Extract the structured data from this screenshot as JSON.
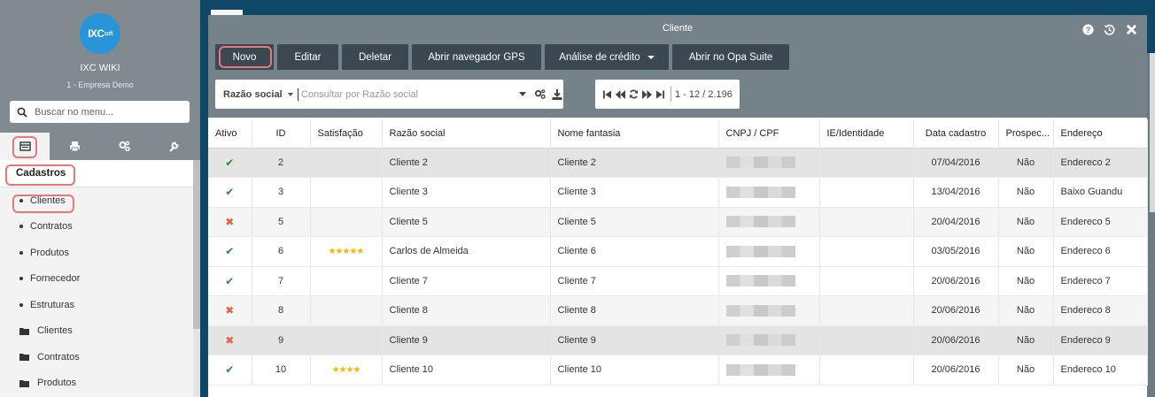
{
  "sidebar": {
    "logo_text": "IXC",
    "logo_sub": "soft",
    "app_name": "IXC WIKI",
    "company": "1 - Empresa Demo",
    "search_placeholder": "Buscar no menu...",
    "tab_icons": [
      "table-icon",
      "print-icon",
      "gears-icon",
      "wrench-icon"
    ],
    "section": "Cadastros",
    "items": [
      {
        "label": "Clientes",
        "type": "dot"
      },
      {
        "label": "Contratos",
        "type": "dot"
      },
      {
        "label": "Produtos",
        "type": "dot"
      },
      {
        "label": "Fornecedor",
        "type": "dot"
      },
      {
        "label": "Estruturas",
        "type": "dot"
      },
      {
        "label": "Clientes",
        "type": "folder"
      },
      {
        "label": "Contratos",
        "type": "folder"
      },
      {
        "label": "Produtos",
        "type": "folder"
      }
    ]
  },
  "window": {
    "title": "Cliente",
    "controls": [
      "help-icon",
      "history-icon",
      "close-icon"
    ],
    "toolbar": {
      "novo": "Novo",
      "editar": "Editar",
      "deletar": "Deletar",
      "gps": "Abrir navegador GPS",
      "credito": "Análise de crédito",
      "opa": "Abrir no Opa Suite"
    },
    "filter": {
      "field": "Razão social",
      "placeholder": "Consultar por Razão social"
    },
    "pager": {
      "info": "1 - 12 / 2.196"
    }
  },
  "table": {
    "columns": [
      "Ativo",
      "ID",
      "Satisfação",
      "Razão social",
      "Nome fantasia",
      "CNPJ / CPF",
      "IE/Identidade",
      "Data cadastro",
      "Prospec...",
      "Endereço"
    ],
    "rows": [
      {
        "ativo": "✔",
        "ok": true,
        "id": "2",
        "sat": "",
        "razao": "Cliente 2",
        "fantasia": "Cliente 2",
        "data": "07/04/2016",
        "prospec": "Não",
        "endereco": "Endereco 2"
      },
      {
        "ativo": "✔",
        "ok": true,
        "id": "3",
        "sat": "",
        "razao": "Cliente 3",
        "fantasia": "Cliente 3",
        "data": "13/04/2016",
        "prospec": "Não",
        "endereco": "Baixo Guandu"
      },
      {
        "ativo": "✖",
        "ok": false,
        "id": "5",
        "sat": "",
        "razao": "Cliente 5",
        "fantasia": "Cliente 5",
        "data": "20/04/2016",
        "prospec": "Não",
        "endereco": "Endereco 5"
      },
      {
        "ativo": "✔",
        "ok": true,
        "id": "6",
        "sat": "★★★★★",
        "razao": "Carlos de Almeida",
        "fantasia": "Cliente 6",
        "data": "03/05/2016",
        "prospec": "Não",
        "endereco": "Endereco 6"
      },
      {
        "ativo": "✔",
        "ok": true,
        "id": "7",
        "sat": "",
        "razao": "Cliente 7",
        "fantasia": "Cliente 7",
        "data": "20/06/2016",
        "prospec": "Não",
        "endereco": "Endereco 7"
      },
      {
        "ativo": "✖",
        "ok": false,
        "id": "8",
        "sat": "",
        "razao": "Cliente 8",
        "fantasia": "Cliente 8",
        "data": "20/06/2016",
        "prospec": "Não",
        "endereco": "Endereco 8"
      },
      {
        "ativo": "✖",
        "ok": false,
        "id": "9",
        "sat": "",
        "razao": "Cliente 9",
        "fantasia": "Cliente 9",
        "data": "20/06/2016",
        "prospec": "Não",
        "endereco": "Endereco 9"
      },
      {
        "ativo": "✔",
        "ok": true,
        "id": "10",
        "sat": "★★★★",
        "razao": "Cliente 10",
        "fantasia": "Cliente 10",
        "data": "20/06/2016",
        "prospec": "Não",
        "endereco": "Endereco 10"
      }
    ]
  },
  "colors": {
    "sidebar_bg": "#808a8f",
    "header_bg": "#76828a",
    "button_bg": "#3b4852",
    "page_bg": "#0e4866",
    "highlight": "#e8767a",
    "ok": "#2e8b2e",
    "no": "#e8643c",
    "star": "#f5b800"
  }
}
